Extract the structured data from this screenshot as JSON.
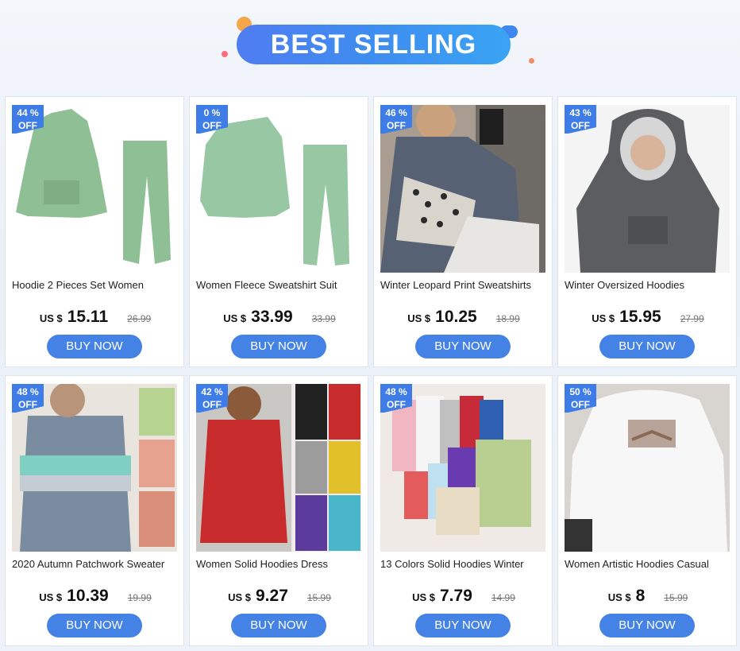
{
  "banner": {
    "title": "BEST SELLING"
  },
  "products": [
    {
      "discount_line1": "44 %",
      "discount_line2": "OFF",
      "title": "Hoodie 2 Pieces Set Women",
      "currency": "US $",
      "price": "15.11",
      "old_price": "26.99",
      "buy_label": "BUY NOW",
      "image_icon": "green-hoodie-set-image"
    },
    {
      "discount_line1": "0 %",
      "discount_line2": "OFF",
      "title": "Women Fleece Sweatshirt Suit",
      "currency": "US $",
      "price": "33.99",
      "old_price": "33.99",
      "buy_label": "BUY NOW",
      "image_icon": "green-sweatshirt-suit-image"
    },
    {
      "discount_line1": "46 %",
      "discount_line2": "OFF",
      "title": "Winter Leopard Print Sweatshirts",
      "currency": "US $",
      "price": "10.25",
      "old_price": "18.99",
      "buy_label": "BUY NOW",
      "image_icon": "leopard-sweatshirt-image"
    },
    {
      "discount_line1": "43 %",
      "discount_line2": "OFF",
      "title": "Winter Oversized Hoodies",
      "currency": "US $",
      "price": "15.95",
      "old_price": "27.99",
      "buy_label": "BUY NOW",
      "image_icon": "oversized-hoodie-image"
    },
    {
      "discount_line1": "48 %",
      "discount_line2": "OFF",
      "title": "2020 Autumn Patchwork Sweater",
      "currency": "US $",
      "price": "10.39",
      "old_price": "19.99",
      "buy_label": "BUY NOW",
      "image_icon": "patchwork-sweater-image"
    },
    {
      "discount_line1": "42 %",
      "discount_line2": "OFF",
      "title": "Women Solid Hoodies Dress",
      "currency": "US $",
      "price": "9.27",
      "old_price": "15.99",
      "buy_label": "BUY NOW",
      "image_icon": "hoodie-dress-image"
    },
    {
      "discount_line1": "48 %",
      "discount_line2": "OFF",
      "title": "13 Colors Solid Hoodies Winter",
      "currency": "US $",
      "price": "7.79",
      "old_price": "14.99",
      "buy_label": "BUY NOW",
      "image_icon": "colorful-hoodies-image"
    },
    {
      "discount_line1": "50 %",
      "discount_line2": "OFF",
      "title": "Women Artistic Hoodies Casual",
      "currency": "US $",
      "price": "8",
      "old_price": "15.99",
      "buy_label": "BUY NOW",
      "image_icon": "artistic-hoodie-image"
    }
  ]
}
